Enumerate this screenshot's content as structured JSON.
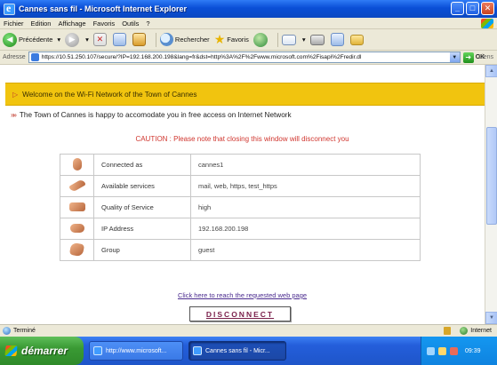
{
  "window": {
    "title": "Cannes sans fil - Microsoft Internet Explorer",
    "controls": {
      "minimize": "_",
      "maximize": "□",
      "close": "✕"
    }
  },
  "menu": [
    "Fichier",
    "Edition",
    "Affichage",
    "Favoris",
    "Outils",
    "?"
  ],
  "toolbar": {
    "back_label": "Précédente",
    "search_label": "Rechercher",
    "favorites_label": "Favoris"
  },
  "address": {
    "label": "Adresse",
    "url": "https://10.51.250.107/secure/?IP=192.168.200.198&lang=fr&dst=http%3A%2F%2Fwww.microsoft.com%2Fisapi%2Fredir.dl",
    "go_label": "OK",
    "links_label": "Liens"
  },
  "page": {
    "banner": "Welcome on the Wi-Fi Network of the Town of Cannes",
    "intro": "The Town of Cannes is happy to accomodate you in free access on Internet Network",
    "caution": "CAUTION : Please note that closing this window will disconnect you",
    "info_rows": [
      {
        "icon": "hand-icon",
        "label": "Connected as",
        "value": "cannes1"
      },
      {
        "icon": "services-icon",
        "label": "Available services",
        "value": "mail, web, https, test_https"
      },
      {
        "icon": "quality-icon",
        "label": "Quality of Service",
        "value": "high"
      },
      {
        "icon": "ip-icon",
        "label": "IP Address",
        "value": "192.168.200.198"
      },
      {
        "icon": "group-icon",
        "label": "Group",
        "value": "guest"
      }
    ],
    "reach_link": "Click here to reach the requested web page",
    "disconnect_label": "DISCONNECT"
  },
  "status": {
    "text": "Terminé",
    "zone": "Internet"
  },
  "taskbar": {
    "start_label": "démarrer",
    "tasks": [
      {
        "label": "http://www.microsoft...",
        "active": false
      },
      {
        "label": "Cannes sans fil - Micr...",
        "active": true
      }
    ],
    "clock": "09:39"
  },
  "colors": {
    "banner": "#f1c40f",
    "caution_text": "#d0362f",
    "link_text": "#4b2c8f",
    "titlebar": "#0a4fd6"
  }
}
